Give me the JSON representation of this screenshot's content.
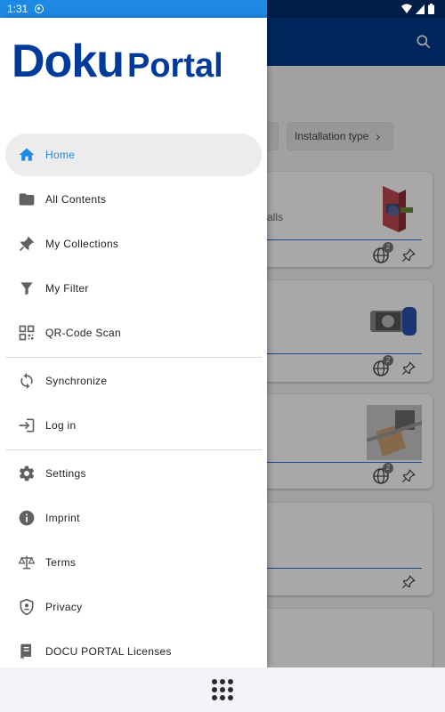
{
  "status_bar": {
    "time": "1:31"
  },
  "drawer": {
    "logo": {
      "part1": "Doku",
      "part2": "Portal"
    },
    "items": [
      {
        "label": "Home",
        "icon": "home-icon",
        "active": true
      },
      {
        "label": "All Contents",
        "icon": "folder-icon"
      },
      {
        "label": "My Collections",
        "icon": "pin-icon"
      },
      {
        "label": "My Filter",
        "icon": "filter-icon"
      },
      {
        "label": "QR-Code Scan",
        "icon": "qr-code-icon"
      },
      {
        "label": "Synchronize",
        "icon": "sync-icon"
      },
      {
        "label": "Log in",
        "icon": "login-icon"
      },
      {
        "label": "Settings",
        "icon": "gear-icon"
      },
      {
        "label": "Imprint",
        "icon": "info-icon"
      },
      {
        "label": "Terms",
        "icon": "scale-icon"
      },
      {
        "label": "Privacy",
        "icon": "shield-icon"
      },
      {
        "label": "DOCU PORTAL Licenses",
        "icon": "license-icon"
      }
    ]
  },
  "background": {
    "filter_chip": "Installation type",
    "card_snippet": "alls",
    "badge_count": "2"
  },
  "colors": {
    "brand": "#003b9b",
    "accent": "#1e88e5",
    "appbar": "#003a8c"
  }
}
